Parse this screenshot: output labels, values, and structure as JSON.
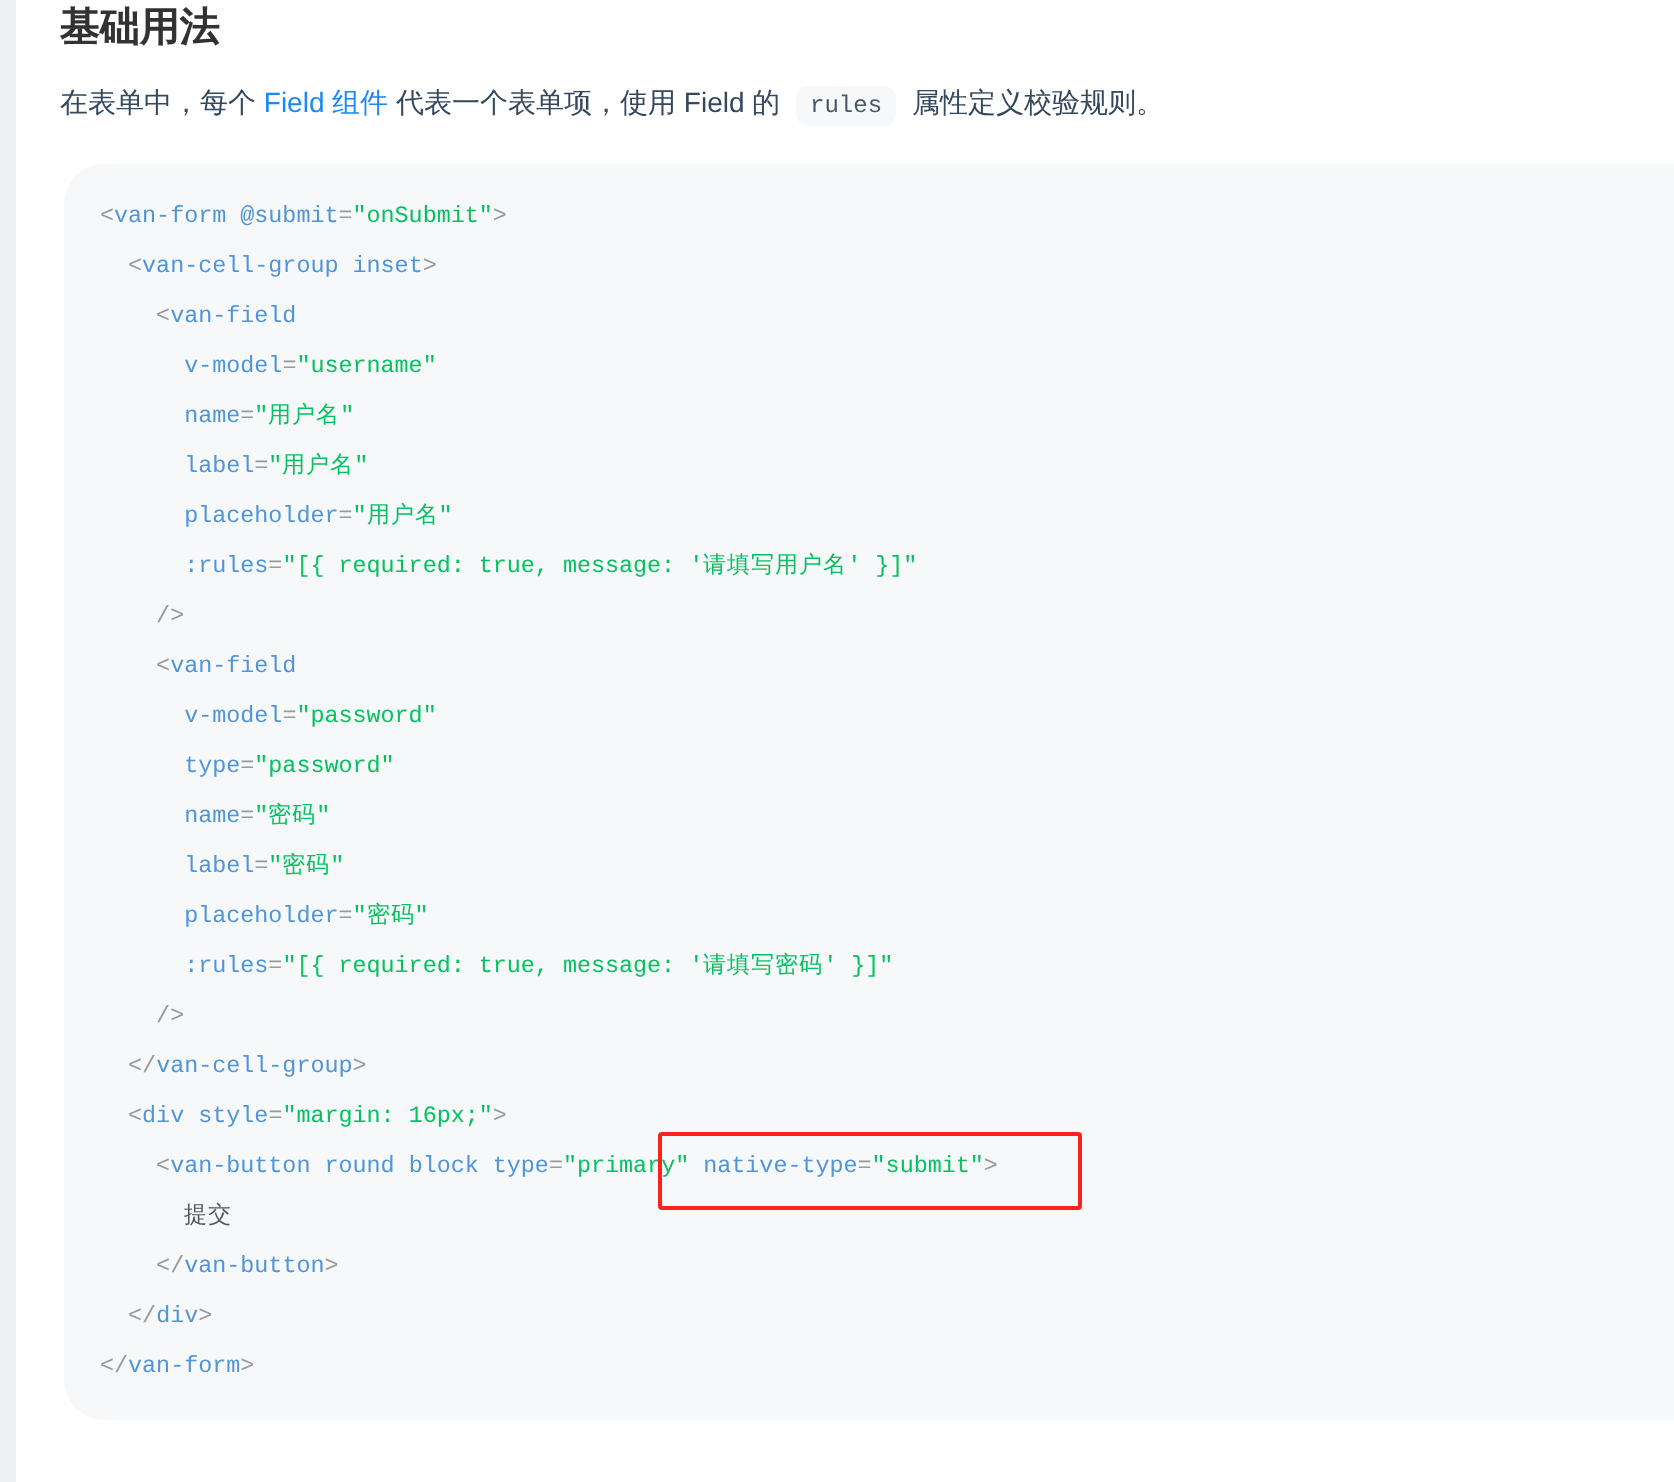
{
  "heading": "基础用法",
  "intro": [
    {
      "kind": "text",
      "text": "在表单中，每个 "
    },
    {
      "kind": "link",
      "text": "Field 组件"
    },
    {
      "kind": "text",
      "text": " 代表一个表单项，使用 Field 的 "
    },
    {
      "kind": "code",
      "text": "rules"
    },
    {
      "kind": "text",
      "text": " 属性定义校验规则。"
    }
  ],
  "code_lines": [
    [
      {
        "kind": "punct",
        "text": "<"
      },
      {
        "kind": "tag",
        "text": "van-form"
      },
      {
        "kind": "attr",
        "text": " @submit"
      },
      {
        "kind": "punct",
        "text": "="
      },
      {
        "kind": "string",
        "text": "\"onSubmit\""
      },
      {
        "kind": "punct",
        "text": ">"
      }
    ],
    [
      {
        "kind": "punct",
        "text": "  <"
      },
      {
        "kind": "tag",
        "text": "van-cell-group"
      },
      {
        "kind": "attr",
        "text": " inset"
      },
      {
        "kind": "punct",
        "text": ">"
      }
    ],
    [
      {
        "kind": "punct",
        "text": "    <"
      },
      {
        "kind": "tag",
        "text": "van-field"
      }
    ],
    [
      {
        "kind": "attr",
        "text": "      v-model"
      },
      {
        "kind": "punct",
        "text": "="
      },
      {
        "kind": "string",
        "text": "\"username\""
      }
    ],
    [
      {
        "kind": "attr",
        "text": "      name"
      },
      {
        "kind": "punct",
        "text": "="
      },
      {
        "kind": "string",
        "text": "\"用户名\""
      }
    ],
    [
      {
        "kind": "attr",
        "text": "      label"
      },
      {
        "kind": "punct",
        "text": "="
      },
      {
        "kind": "string",
        "text": "\"用户名\""
      }
    ],
    [
      {
        "kind": "attr",
        "text": "      placeholder"
      },
      {
        "kind": "punct",
        "text": "="
      },
      {
        "kind": "string",
        "text": "\"用户名\""
      }
    ],
    [
      {
        "kind": "attr",
        "text": "      :rules"
      },
      {
        "kind": "punct",
        "text": "="
      },
      {
        "kind": "string",
        "text": "\"[{ required: true, message: '请填写用户名' }]\""
      }
    ],
    [
      {
        "kind": "punct",
        "text": "    />"
      }
    ],
    [
      {
        "kind": "punct",
        "text": "    <"
      },
      {
        "kind": "tag",
        "text": "van-field"
      }
    ],
    [
      {
        "kind": "attr",
        "text": "      v-model"
      },
      {
        "kind": "punct",
        "text": "="
      },
      {
        "kind": "string",
        "text": "\"password\""
      }
    ],
    [
      {
        "kind": "attr",
        "text": "      type"
      },
      {
        "kind": "punct",
        "text": "="
      },
      {
        "kind": "string",
        "text": "\"password\""
      }
    ],
    [
      {
        "kind": "attr",
        "text": "      name"
      },
      {
        "kind": "punct",
        "text": "="
      },
      {
        "kind": "string",
        "text": "\"密码\""
      }
    ],
    [
      {
        "kind": "attr",
        "text": "      label"
      },
      {
        "kind": "punct",
        "text": "="
      },
      {
        "kind": "string",
        "text": "\"密码\""
      }
    ],
    [
      {
        "kind": "attr",
        "text": "      placeholder"
      },
      {
        "kind": "punct",
        "text": "="
      },
      {
        "kind": "string",
        "text": "\"密码\""
      }
    ],
    [
      {
        "kind": "attr",
        "text": "      :rules"
      },
      {
        "kind": "punct",
        "text": "="
      },
      {
        "kind": "string",
        "text": "\"[{ required: true, message: '请填写密码' }]\""
      }
    ],
    [
      {
        "kind": "punct",
        "text": "    />"
      }
    ],
    [
      {
        "kind": "punct",
        "text": "  </"
      },
      {
        "kind": "tag",
        "text": "van-cell-group"
      },
      {
        "kind": "punct",
        "text": ">"
      }
    ],
    [
      {
        "kind": "punct",
        "text": "  <"
      },
      {
        "kind": "tag",
        "text": "div"
      },
      {
        "kind": "attr",
        "text": " style"
      },
      {
        "kind": "punct",
        "text": "="
      },
      {
        "kind": "string",
        "text": "\"margin: 16px;\""
      },
      {
        "kind": "punct",
        "text": ">"
      }
    ],
    [
      {
        "kind": "punct",
        "text": "    <"
      },
      {
        "kind": "tag",
        "text": "van-button"
      },
      {
        "kind": "attr",
        "text": " round block type"
      },
      {
        "kind": "punct",
        "text": "="
      },
      {
        "kind": "string",
        "text": "\"primar"
      },
      {
        "kind": "string",
        "text": "y\"",
        "boxed": true
      },
      {
        "kind": "attr",
        "text": " native-type",
        "boxed": true
      },
      {
        "kind": "punct",
        "text": "=",
        "boxed": true
      },
      {
        "kind": "string",
        "text": "\"submit\"",
        "boxed": true
      },
      {
        "kind": "punct",
        "text": ">",
        "boxed": true
      }
    ],
    [
      {
        "kind": "text",
        "text": "      提交"
      }
    ],
    [
      {
        "kind": "punct",
        "text": "    </"
      },
      {
        "kind": "tag",
        "text": "van-button"
      },
      {
        "kind": "punct",
        "text": ">"
      }
    ],
    [
      {
        "kind": "punct",
        "text": "  </"
      },
      {
        "kind": "tag",
        "text": "div"
      },
      {
        "kind": "punct",
        "text": ">"
      }
    ],
    [
      {
        "kind": "punct",
        "text": "</"
      },
      {
        "kind": "tag",
        "text": "van-form"
      },
      {
        "kind": "punct",
        "text": ">"
      }
    ]
  ]
}
